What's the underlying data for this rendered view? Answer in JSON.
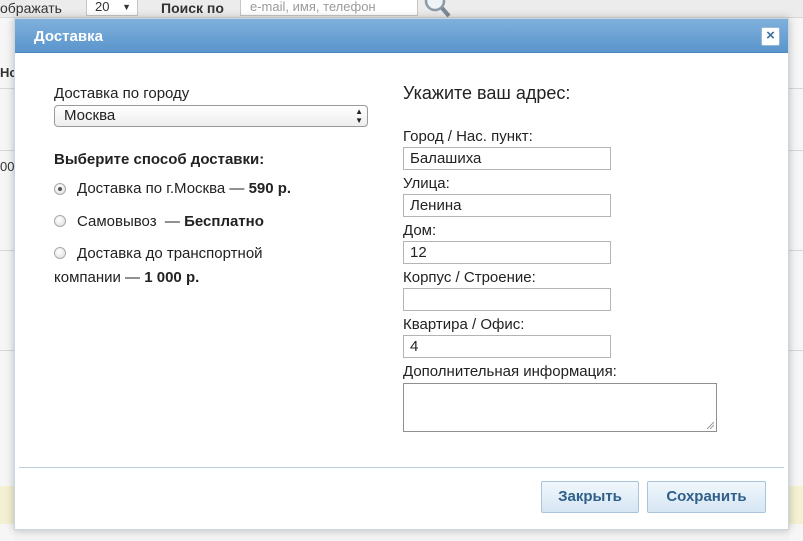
{
  "background": {
    "show_label_fragment": "ображать",
    "per_page_value": "20",
    "search_label": "Поиск по",
    "search_placeholder": "e-mail, имя, телефон",
    "fragment_left_1": "Но",
    "fragment_left_2": "00"
  },
  "modal": {
    "title": "Доставка",
    "close_symbol": "×",
    "delivery_city_label": "Доставка по городу",
    "city_select_value": "Москва",
    "delivery_method_title": "Выберите способ доставки:",
    "options": [
      {
        "text": "Доставка по г.Москва — ",
        "price": "590 р.",
        "checked": true
      },
      {
        "text": "Самовывоз  — ",
        "price": "Бесплатно",
        "checked": false
      },
      {
        "text_line1": "Доставка до транспортной",
        "text_line2": "компании — ",
        "price": "1 000 р.",
        "checked": false
      }
    ],
    "address_title": "Укажите ваш адрес:",
    "fields": {
      "city_label": "Город / Нас. пункт:",
      "city_value": "Балашиха",
      "street_label": "Улица:",
      "street_value": "Ленина",
      "house_label": "Дом:",
      "house_value": "12",
      "building_label": "Корпус / Строение:",
      "building_value": "",
      "apartment_label": "Квартира / Офис:",
      "apartment_value": "4",
      "extra_label": "Дополнительная информация:",
      "extra_value": ""
    },
    "buttons": {
      "close_label": "Закрыть",
      "save_label": "Сохранить"
    }
  },
  "colors": {
    "header_blue": "#5a95cc",
    "button_text": "#2f5f8a"
  }
}
